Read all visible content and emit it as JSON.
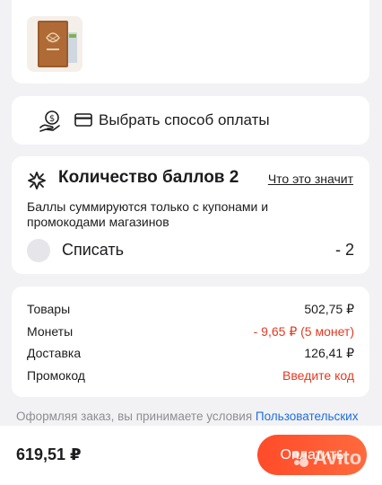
{
  "payment": {
    "label": "Выбрать способ оплаты",
    "icons": [
      "coin-hand-icon",
      "credit-card-icon"
    ]
  },
  "points": {
    "title": "Количество баллов 2",
    "info_link": "Что это значит",
    "description": "Баллы суммируются только с купонами и промокодами магазинов",
    "use_label": "Списать",
    "use_value": "- 2",
    "icon": "points-star-icon"
  },
  "summary": {
    "rows": [
      {
        "label": "Товары",
        "value": "502,75 ₽"
      },
      {
        "label": "Монеты",
        "value": "- 9,65 ₽ (5 монет)"
      },
      {
        "label": "Доставка",
        "value": "126,41 ₽"
      },
      {
        "label": "Промокод",
        "value": "Введите код"
      }
    ]
  },
  "terms": {
    "text": "Оформляя заказ, вы принимаете условия ",
    "link": "Пользовательских"
  },
  "bottom": {
    "total": "619,51 ₽",
    "pay_button": "Оплатить"
  },
  "watermark": {
    "text": "Avito"
  },
  "colors": {
    "accent": "#ff5a2e",
    "discount": "#e33a22",
    "link": "#1f6fe0",
    "background": "#f2f2f5"
  }
}
